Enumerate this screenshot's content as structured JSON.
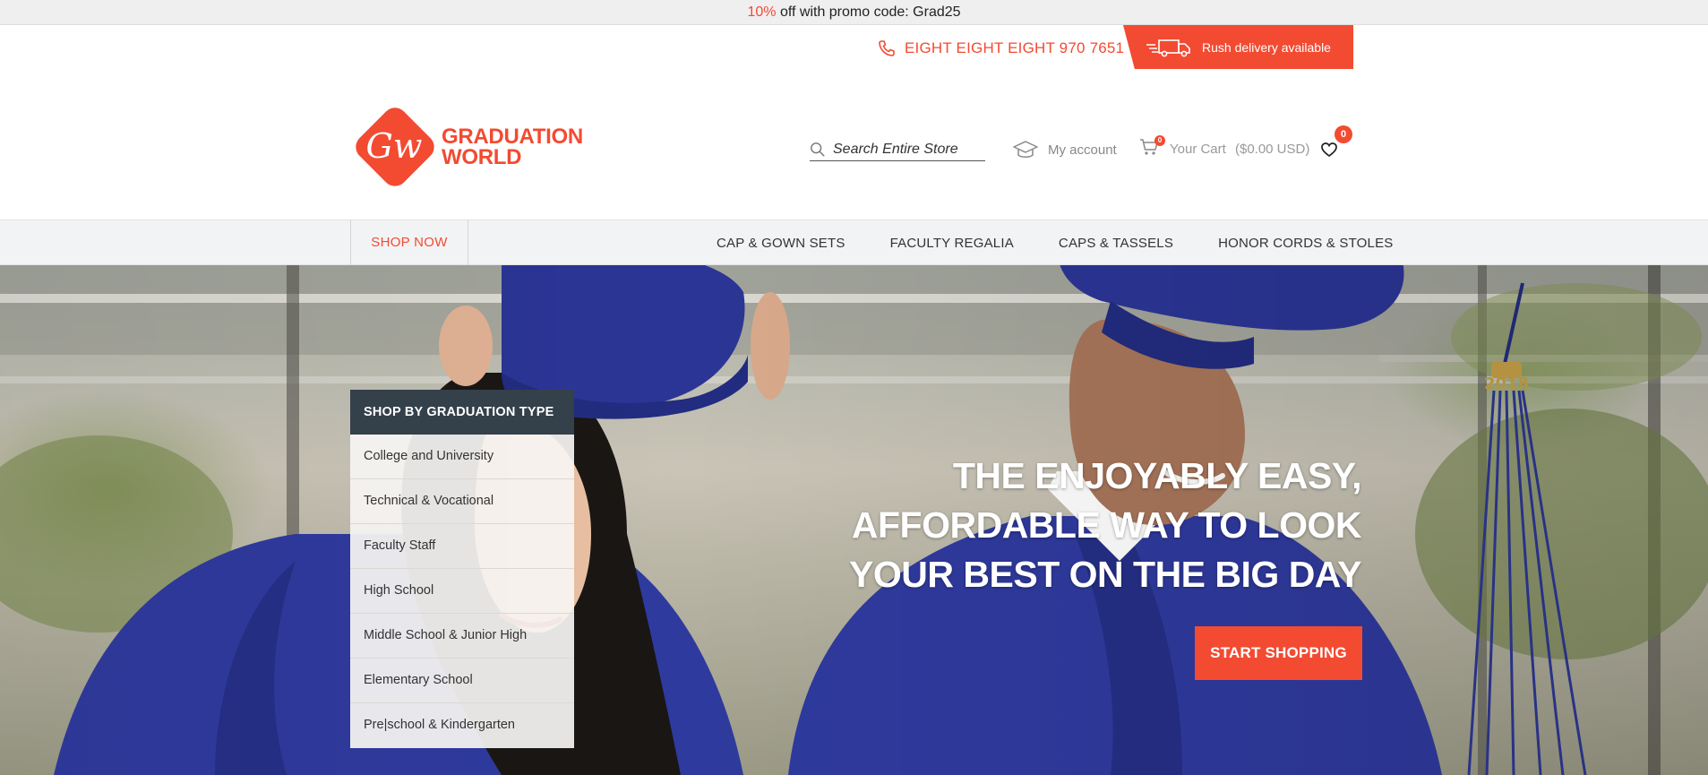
{
  "promo": {
    "percent": "10%",
    "text": "off with promo code: Grad25"
  },
  "utility": {
    "phone": "EIGHT EIGHT EIGHT 970 7651",
    "rush": "Rush delivery available"
  },
  "logo": {
    "line1": "GRADUATION",
    "line2": "WORLD",
    "monogram": "Gw"
  },
  "header": {
    "search_placeholder": "Search Entire Store",
    "account": "My account",
    "cart_label": "Your Cart",
    "cart_total": "($0.00 USD)",
    "cart_count": "0",
    "wishlist_count": "0"
  },
  "nav": {
    "shop_now": "SHOP NOW",
    "links": [
      "CAP & GOWN SETS",
      "FACULTY REGALIA",
      "CAPS & TASSELS",
      "HONOR CORDS & STOLES"
    ]
  },
  "hero": {
    "menu_title": "SHOP BY GRADUATION TYPE",
    "menu_items": [
      "College and University",
      "Technical & Vocational",
      "Faculty Staff",
      "High School",
      "Middle School & Junior High",
      "Elementary School",
      "Pre|school & Kindergarten"
    ],
    "headline": [
      "THE ENJOYABLY EASY,",
      "AFFORDABLE WAY TO LOOK",
      "YOUR BEST ON THE BIG DAY"
    ],
    "cta": "START SHOPPING",
    "tassel_year": "2018"
  },
  "colors": {
    "accent": "#f24b32",
    "menu_header": "#34404a",
    "nav_bg": "#f2f3f5",
    "gown": "#2f3a9e"
  },
  "icons": [
    "phone-icon",
    "truck-icon",
    "search-icon",
    "graduation-cap-icon",
    "cart-icon",
    "heart-icon"
  ]
}
